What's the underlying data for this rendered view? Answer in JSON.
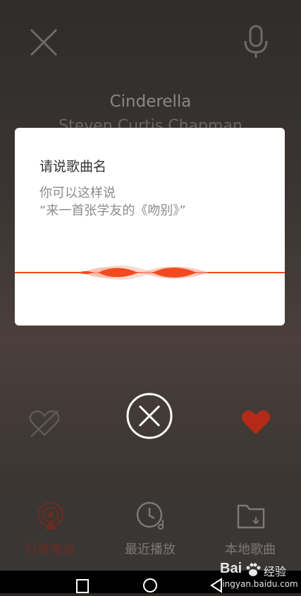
{
  "player": {
    "song_title": "Cinderella",
    "artist": "Steven Curtis Chapman"
  },
  "dialog": {
    "title": "请说歌曲名",
    "hint_line1": "你可以这样说",
    "hint_line2": "“来一首张学友的《吻别》”"
  },
  "tabs": [
    {
      "label": "行家电台",
      "icon": "radio-icon",
      "active": true
    },
    {
      "label": "最近播放",
      "icon": "clock-icon",
      "active": false
    },
    {
      "label": "本地歌曲",
      "icon": "folder-icon",
      "active": false
    }
  ],
  "watermark": {
    "brand": "Bai",
    "jingyan": "经验",
    "url": "jingyan.baidu.com"
  },
  "colors": {
    "accent": "#f24a1e",
    "heart": "#b52a16",
    "active_tab": "#6a2c22"
  }
}
